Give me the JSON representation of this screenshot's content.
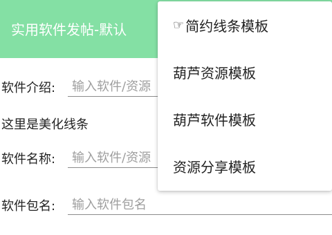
{
  "header": {
    "title": "实用软件发帖-默认"
  },
  "form": {
    "intro_label": "软件介绍:",
    "intro_placeholder": "输入软件/资源",
    "note": "这里是美化线条",
    "name_label": "软件名称:",
    "name_placeholder": "输入软件/资源",
    "package_label": "软件包名:",
    "package_placeholder": "输入软件包名"
  },
  "menu": {
    "items": [
      {
        "label": "简约线条模板",
        "selected": true,
        "marker": "☞"
      },
      {
        "label": "葫芦资源模板"
      },
      {
        "label": "葫芦软件模板"
      },
      {
        "label": "资源分享模板"
      }
    ]
  },
  "colors": {
    "header_bg": "#84e0a4",
    "header_text": "#ffffff",
    "underline": "#8a8a8a",
    "placeholder": "#9e9e9e"
  }
}
